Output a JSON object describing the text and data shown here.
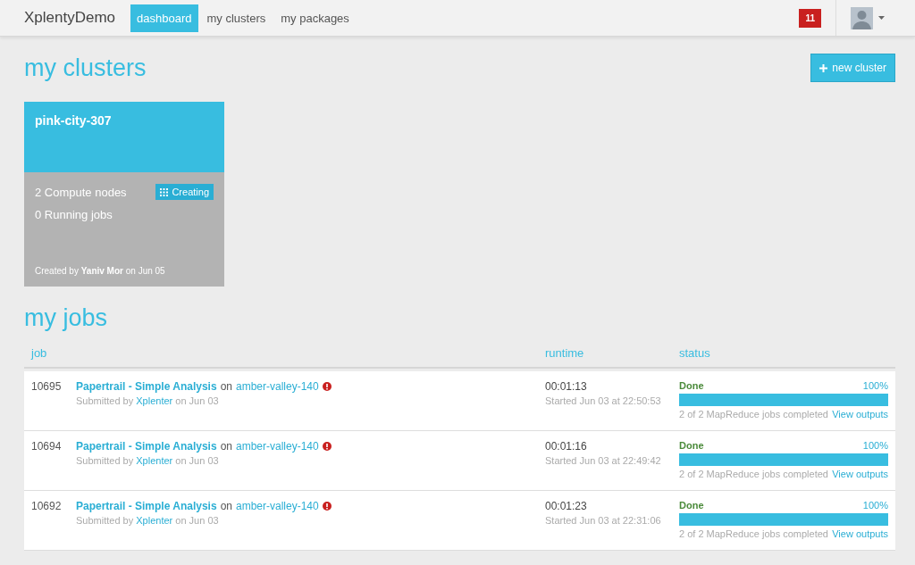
{
  "brand": "XplentyDemo",
  "nav": [
    {
      "label": "dashboard",
      "selected": true
    },
    {
      "label": "my clusters",
      "selected": false
    },
    {
      "label": "my packages",
      "selected": false
    }
  ],
  "notifications": "11",
  "clusters_section": {
    "title": "my clusters",
    "new_button": "new cluster"
  },
  "clusters": [
    {
      "name": "pink-city-307",
      "nodes": "2 Compute nodes",
      "running": "0 Running jobs",
      "status": "Creating",
      "created": "Created by **Yaniv Mor** on Jun 05"
    }
  ],
  "jobs_section": {
    "title": "my jobs"
  },
  "table": {
    "columns": [
      "job",
      "runtime",
      "status"
    ],
    "rows": [
      {
        "id": "10695",
        "package": "Papertrail - Simple Analysis",
        "on": "on",
        "cluster": "amber-valley-140",
        "error": true,
        "submitted_prefix": "Submitted by",
        "submitter": "Xplenter",
        "submitted_suffix": "on Jun 03",
        "runtime": "00:01:13",
        "started": "Started Jun 03 at 22:50:53",
        "status": "Done",
        "percent": "100%",
        "level": 1,
        "summary": "2 of 2 MapReduce jobs completed",
        "outputs": "View outputs"
      },
      {
        "id": "10694",
        "package": "Papertrail - Simple Analysis",
        "on": "on",
        "cluster": "amber-valley-140",
        "error": true,
        "submitted_prefix": "Submitted by",
        "submitter": "Xplenter",
        "submitted_suffix": "on Jun 03",
        "runtime": "00:01:16",
        "started": "Started Jun 03 at 22:49:42",
        "status": "Done",
        "percent": "100%",
        "level": 1,
        "summary": "2 of 2 MapReduce jobs completed",
        "outputs": "View outputs"
      },
      {
        "id": "10692",
        "package": "Papertrail - Simple Analysis",
        "on": "on",
        "cluster": "amber-valley-140",
        "error": true,
        "submitted_prefix": "Submitted by",
        "submitter": "Xplenter",
        "submitted_suffix": "on Jun 03",
        "runtime": "00:01:23",
        "started": "Started Jun 03 at 22:31:06",
        "status": "Done",
        "percent": "100%",
        "level": 1,
        "summary": "2 of 2 MapReduce jobs completed",
        "outputs": "View outputs"
      }
    ]
  }
}
